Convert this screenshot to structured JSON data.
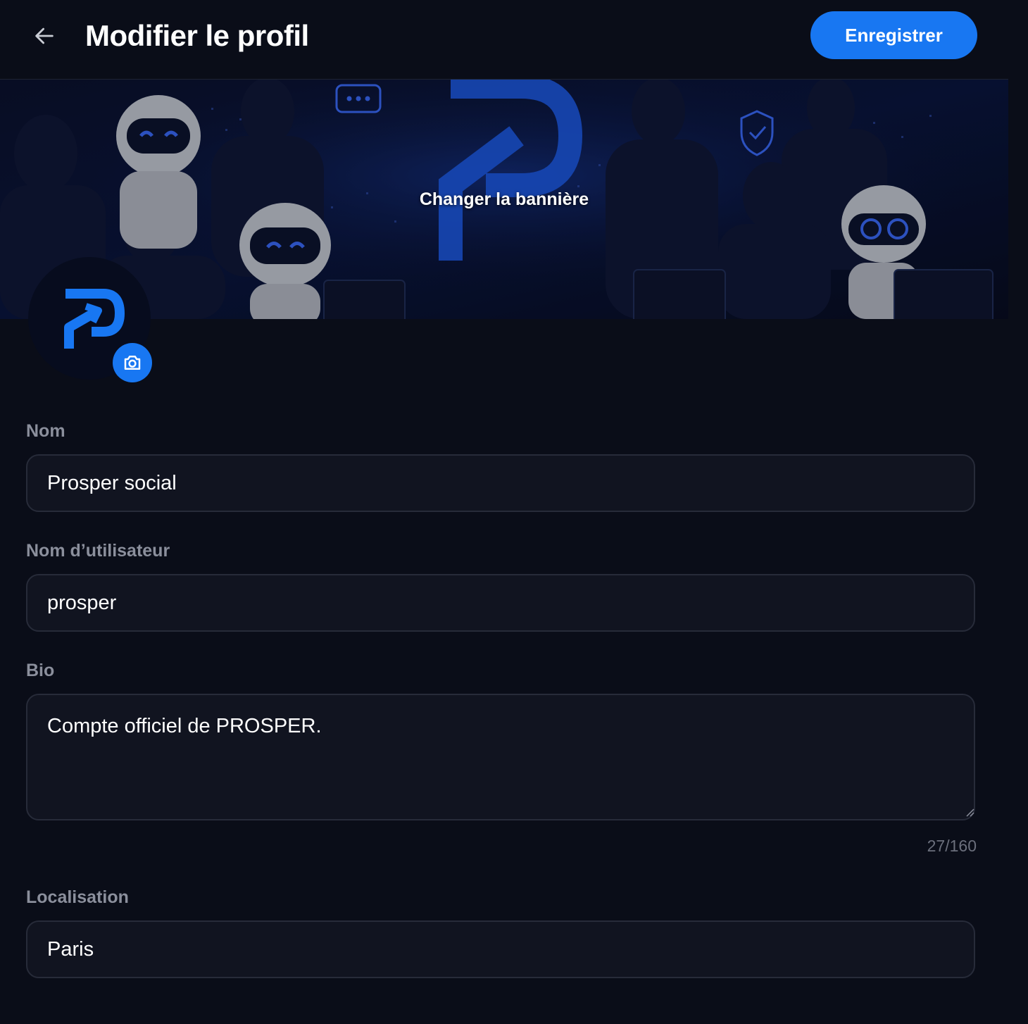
{
  "header": {
    "title": "Modifier le profil",
    "save_label": "Enregistrer",
    "back_icon": "arrow-left-icon"
  },
  "banner": {
    "label": "Changer la bannière"
  },
  "avatar": {
    "camera_icon": "camera-icon"
  },
  "form": {
    "name": {
      "label": "Nom",
      "value": "Prosper social"
    },
    "username": {
      "label": "Nom d’utilisateur",
      "value": "prosper"
    },
    "bio": {
      "label": "Bio",
      "value": "Compte officiel de PROSPER.",
      "counter": "27/160"
    },
    "location": {
      "label": "Localisation",
      "value": "Paris"
    }
  },
  "colors": {
    "background": "#0a0d18",
    "accent": "#1877f2",
    "field_bg": "#111420",
    "field_border": "#272b39",
    "label": "#8b8f9c"
  }
}
